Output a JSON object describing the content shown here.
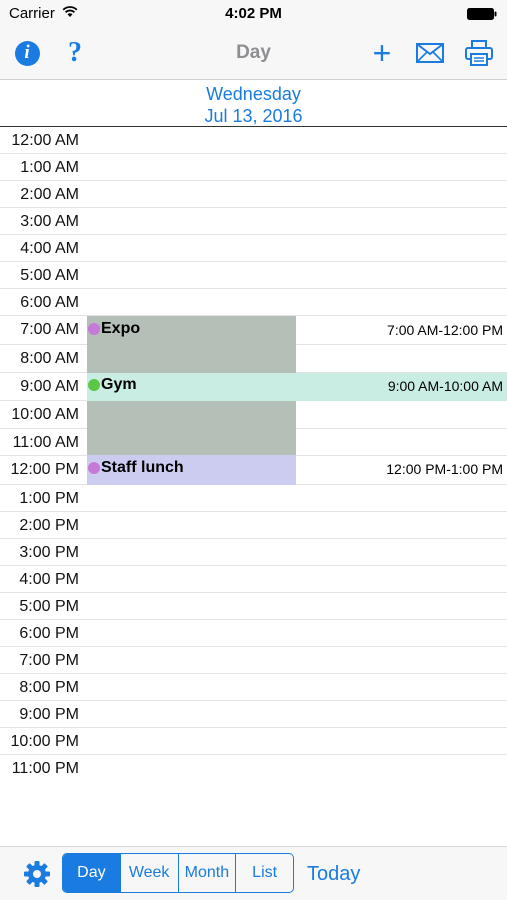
{
  "status_bar": {
    "carrier": "Carrier",
    "time": "4:02 PM"
  },
  "nav_bar": {
    "title": "Day",
    "info_glyph": "i",
    "help_glyph": "?",
    "add_glyph": "+",
    "icons": [
      "info-icon",
      "help-icon",
      "add-icon",
      "mail-icon",
      "print-icon"
    ]
  },
  "date_header": {
    "weekday": "Wednesday",
    "date": "Jul 13, 2016"
  },
  "hours": [
    "12:00 AM",
    "1:00 AM",
    "2:00 AM",
    "3:00 AM",
    "4:00 AM",
    "5:00 AM",
    "6:00 AM",
    "7:00 AM",
    "8:00 AM",
    "9:00 AM",
    "10:00 AM",
    "11:00 AM",
    "12:00 PM",
    "1:00 PM",
    "2:00 PM",
    "3:00 PM",
    "4:00 PM",
    "5:00 PM",
    "6:00 PM",
    "7:00 PM",
    "8:00 PM",
    "9:00 PM",
    "10:00 PM",
    "11:00 PM"
  ],
  "events": [
    {
      "title": "Expo",
      "time_range": "7:00 AM-12:00 PM",
      "dot_color": "#c47ad6",
      "fill_color": "#b3bfb7"
    },
    {
      "title": "Gym",
      "time_range": "9:00 AM-10:00 AM",
      "dot_color": "#5cc646",
      "fill_color": "#c9ede3"
    },
    {
      "title": "Staff lunch",
      "time_range": "12:00 PM-1:00 PM",
      "dot_color": "#c47ad6",
      "fill_color": "#ccccf0"
    }
  ],
  "toolbar": {
    "settings_icon": "gear-icon",
    "segments": [
      "Day",
      "Week",
      "Month",
      "List"
    ],
    "active_segment": "Day",
    "today_label": "Today"
  },
  "colors": {
    "accent": "#1a7ce0"
  }
}
